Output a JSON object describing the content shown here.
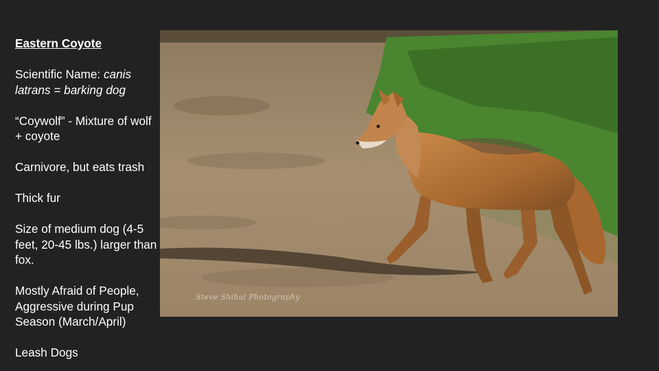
{
  "slide": {
    "title": "Eastern Coyote",
    "scientific_prefix": "Scientific Name: ",
    "scientific_italic": "canis latrans = barking dog",
    "coywolf": "“Coywolf” - Mixture of wolf + coyote",
    "diet": "Carnivore, but eats trash",
    "fur": "Thick fur",
    "size": "Size of medium dog (4-5 feet, 20-45 lbs.) larger than fox.",
    "behavior": "Mostly Afraid of People, Aggressive during Pup Season (March/April)",
    "advice": "Leash Dogs"
  },
  "photo": {
    "watermark": "Steve Shihal Photography",
    "colors": {
      "ground": "#a08a6c",
      "grass": "#3f7a2a",
      "coat": "#b8753a",
      "shadow": "#3a3024"
    }
  }
}
